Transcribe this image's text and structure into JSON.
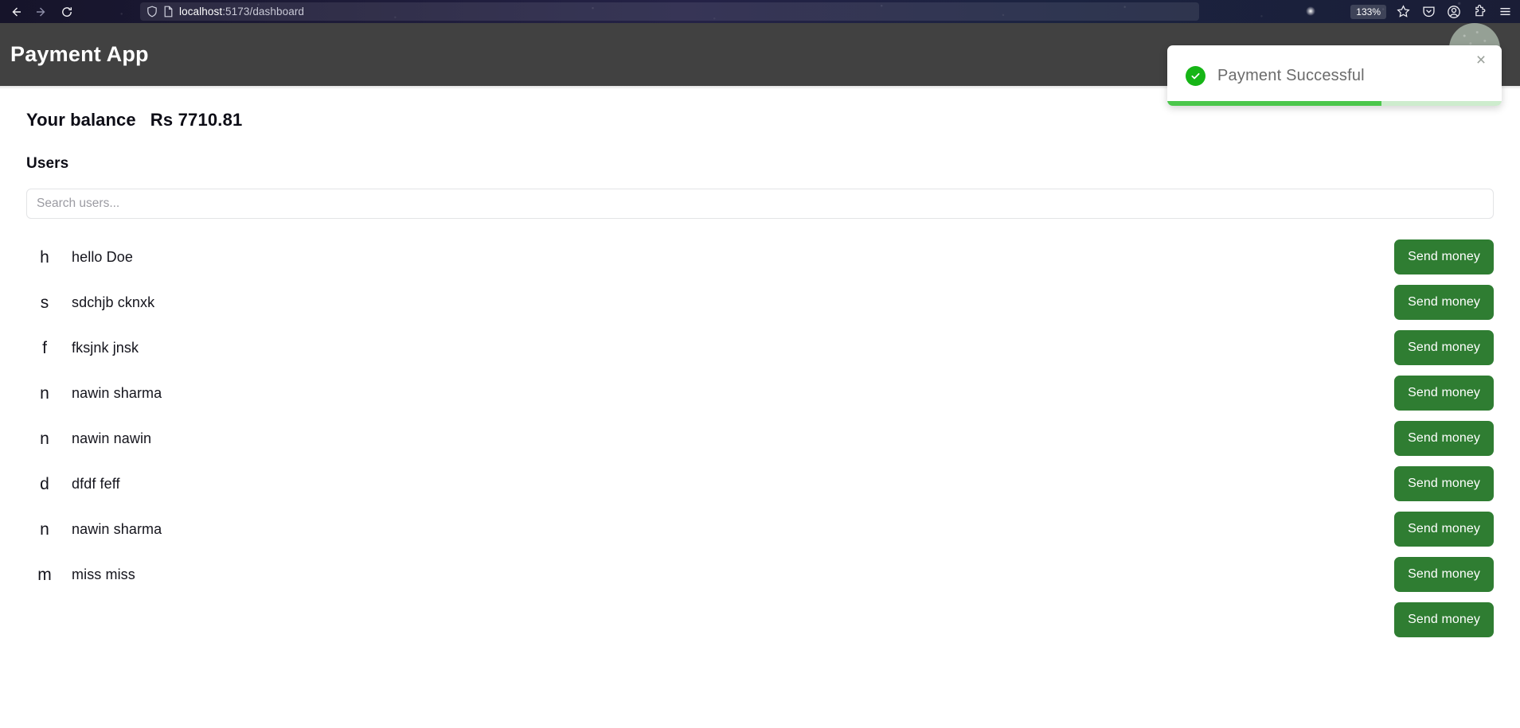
{
  "browser": {
    "back_icon": "back-arrow-icon",
    "forward_icon": "forward-arrow-icon",
    "reload_icon": "reload-icon",
    "shield_icon": "shield-icon",
    "page_icon": "page-document-icon",
    "url_host": "localhost",
    "url_path": ":5173/dashboard",
    "zoom_level": "133%",
    "bookmark_icon": "star-icon",
    "pocket_icon": "pocket-icon",
    "account_icon": "account-circle-icon",
    "extensions_icon": "extensions-puzzle-icon",
    "menu_icon": "hamburger-menu-icon"
  },
  "header": {
    "title": "Payment App",
    "avatar_icon": "user-avatar"
  },
  "balance": {
    "label": "Your balance",
    "value": "Rs 7710.81"
  },
  "users_section": {
    "heading": "Users",
    "search_placeholder": "Search users...",
    "search_value": "",
    "send_label": "Send money",
    "users": [
      {
        "initial": "h",
        "name": "hello Doe"
      },
      {
        "initial": "s",
        "name": "sdchjb cknxk"
      },
      {
        "initial": "f",
        "name": "fksjnk jnsk"
      },
      {
        "initial": "n",
        "name": "nawin sharma"
      },
      {
        "initial": "n",
        "name": "nawin nawin"
      },
      {
        "initial": "d",
        "name": "dfdf feff"
      },
      {
        "initial": "n",
        "name": "nawin sharma"
      },
      {
        "initial": "m",
        "name": "miss miss"
      }
    ]
  },
  "toast": {
    "message": "Payment Successful",
    "check_icon": "check-circle-icon",
    "close_label": "×",
    "progress_percent": 64
  },
  "colors": {
    "header_bg": "#414141",
    "button_green": "#2f7d32",
    "toast_check_green": "#16b516",
    "toast_progress_green": "#4cc74c",
    "toast_progress_track": "#cdeccd"
  }
}
